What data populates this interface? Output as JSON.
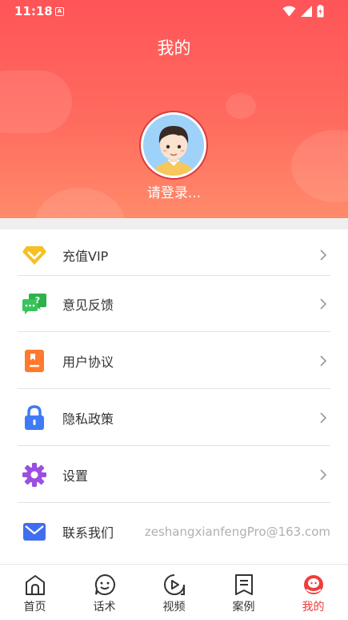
{
  "status_bar": {
    "time": "11:18",
    "badge": "A"
  },
  "header": {
    "title": "我的",
    "login_text": "请登录..."
  },
  "menu": [
    {
      "label": "充值VIP",
      "icon": "diamond-icon"
    },
    {
      "label": "意见反馈",
      "icon": "feedback-chat-icon"
    },
    {
      "label": "用户协议",
      "icon": "agreement-book-icon"
    },
    {
      "label": "隐私政策",
      "icon": "lock-icon"
    },
    {
      "label": "设置",
      "icon": "gear-icon"
    },
    {
      "label": "联系我们",
      "icon": "mail-icon",
      "value": "zeshangxianfengPro@163.com"
    }
  ],
  "bottom_nav": [
    {
      "label": "首页",
      "icon": "home-icon"
    },
    {
      "label": "话术",
      "icon": "smile-icon"
    },
    {
      "label": "视频",
      "icon": "play-icon"
    },
    {
      "label": "案例",
      "icon": "document-icon"
    },
    {
      "label": "我的",
      "icon": "profile-icon",
      "active": true
    }
  ],
  "colors": {
    "brand_red": "#ff5458",
    "active_red": "#f03c3c",
    "vip_yellow": "#f5c021",
    "feedback_green": "#2db14c",
    "agreement_orange": "#ff7a2f",
    "privacy_blue": "#3e7bf5",
    "settings_purple": "#9b4fe0",
    "mail_blue": "#3f6ff0"
  }
}
